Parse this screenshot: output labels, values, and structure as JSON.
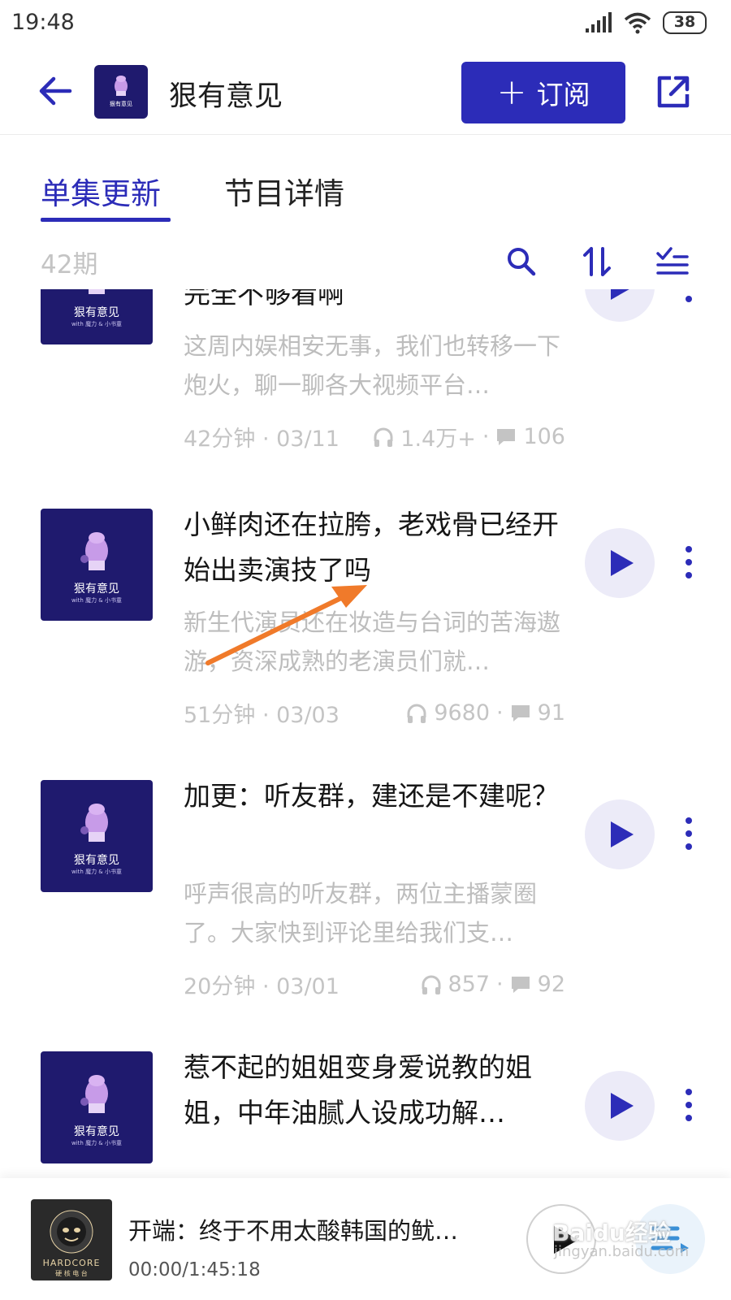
{
  "status_bar": {
    "time": "19:48",
    "battery": "38",
    "icons": [
      "signal-icon",
      "wifi-icon",
      "battery-icon"
    ]
  },
  "header": {
    "title": "狠有意见",
    "subscribe_label": "订阅",
    "icons": [
      "back-arrow-icon",
      "share-icon"
    ],
    "accent_color": "#2c2cb8"
  },
  "tabs": [
    {
      "label": "单集更新",
      "active": true
    },
    {
      "label": "节目详情",
      "active": false
    }
  ],
  "toolbar": {
    "episode_count": "42期",
    "icons": [
      "search-icon",
      "sort-icon",
      "filter-list-icon"
    ]
  },
  "cover": {
    "name": "狠有意见",
    "sub": "with 魔力 & 小书童"
  },
  "episodes": [
    {
      "title": "完全不够看啊",
      "description": "这周内娱相安无事，我们也转移一下炮火，聊一聊各大视频平台…",
      "duration_date": "42分钟 · 03/11",
      "plays": "1.4万+",
      "comments": "106"
    },
    {
      "title": "小鲜肉还在拉胯，老戏骨已经开始出卖演技了吗",
      "description": "新生代演员还在妆造与台词的苦海遨游，资深成熟的老演员们就…",
      "duration_date": "51分钟 · 03/03",
      "plays": "9680",
      "comments": "91"
    },
    {
      "title": "加更：听友群，建还是不建呢？",
      "description": "呼声很高的听友群，两位主播蒙圈了。大家快到评论里给我们支…",
      "duration_date": "20分钟 · 03/01",
      "plays": "857",
      "comments": "92"
    },
    {
      "title": "惹不起的姐姐变身爱说教的姐姐，中年油腻人设成功解…",
      "description": "",
      "duration_date": "",
      "plays": "",
      "comments": ""
    }
  ],
  "player": {
    "title": "开端：终于不用太酸韩国的鱿…",
    "time": "00:00/1:45:18",
    "cover_label": "HARDCORE",
    "cover_sub": "硬 核 电 台",
    "icons": [
      "play-icon",
      "playlist-icon"
    ]
  },
  "watermark": {
    "text": "Baidu经验",
    "sub": "jingyan.baidu.com"
  }
}
